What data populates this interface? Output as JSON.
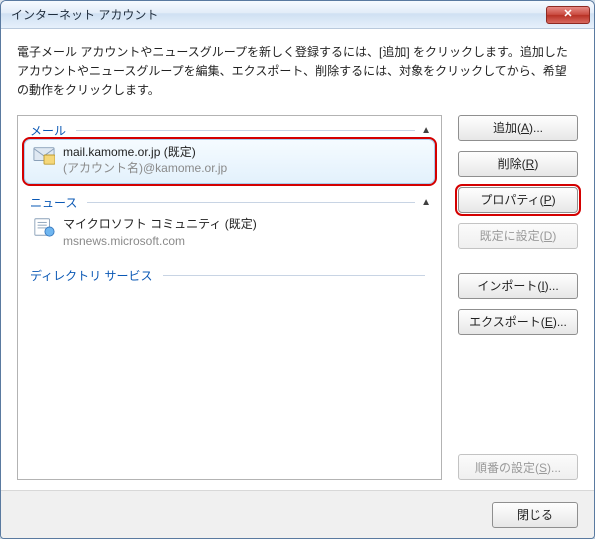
{
  "window": {
    "title": "インターネット アカウント",
    "close_glyph": "✕"
  },
  "description": "電子メール アカウントやニュースグループを新しく登録するには、[追加] をクリックします。追加したアカウントやニュースグループを編集、エクスポート、削除するには、対象をクリックしてから、希望の動作をクリックします。",
  "groups": {
    "mail": {
      "label": "メール",
      "chevron": "▲",
      "items": [
        {
          "primary": "mail.kamome.or.jp (既定)",
          "secondary": "(アカウント名)@kamome.or.jp",
          "selected": true
        }
      ]
    },
    "news": {
      "label": "ニュース",
      "chevron": "▲",
      "items": [
        {
          "primary": "マイクロソフト コミュニティ (既定)",
          "secondary": "msnews.microsoft.com",
          "selected": false
        }
      ]
    },
    "directory": {
      "label": "ディレクトリ サービス",
      "chevron": ""
    }
  },
  "buttons": {
    "add": {
      "label_pre": "追加(",
      "accel": "A",
      "label_post": ")..."
    },
    "remove": {
      "label_pre": "削除(",
      "accel": "R",
      "label_post": ")"
    },
    "properties": {
      "label_pre": "プロパティ(",
      "accel": "P",
      "label_post": ")"
    },
    "default": {
      "label_pre": "既定に設定(",
      "accel": "D",
      "label_post": ")"
    },
    "import": {
      "label_pre": "インポート(",
      "accel": "I",
      "label_post": ")..."
    },
    "export": {
      "label_pre": "エクスポート(",
      "accel": "E",
      "label_post": ")..."
    },
    "order": {
      "label_pre": "順番の設定(",
      "accel": "S",
      "label_post": ")..."
    },
    "close": {
      "label": "閉じる"
    }
  }
}
